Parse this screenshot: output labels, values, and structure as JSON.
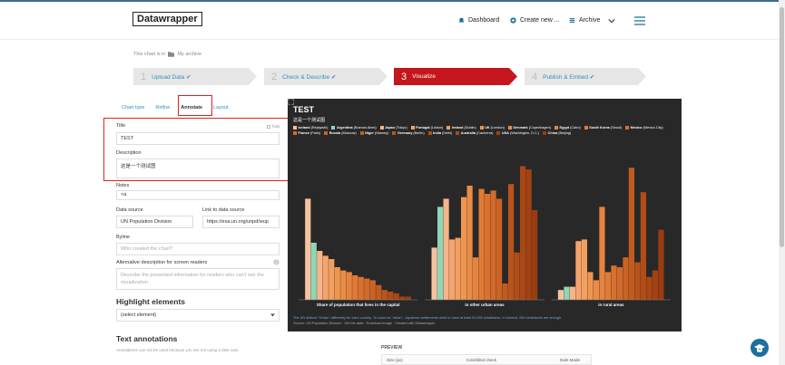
{
  "header": {
    "logo": "Datawrapper",
    "nav": [
      {
        "label": "Dashboard",
        "icon": "bell-icon"
      },
      {
        "label": "Create new ...",
        "icon": "plus-circle-icon"
      },
      {
        "label": "Archive",
        "icon": "folder-icon"
      }
    ]
  },
  "breadcrumb": {
    "prefix": "This chart is in",
    "folder": "My archive"
  },
  "steps": [
    {
      "num": "1",
      "label": "Upload Data ✔"
    },
    {
      "num": "2",
      "label": "Check & Describe ✔"
    },
    {
      "num": "3",
      "label": "Visualize"
    },
    {
      "num": "4",
      "label": "Publish & Embed ✔"
    }
  ],
  "tabs": [
    "Chart type",
    "Refine",
    "Annotate",
    "Layout"
  ],
  "form": {
    "title_label": "Title",
    "hide_label": "hide",
    "title_value": "TEST",
    "description_label": "Description",
    "description_value": "这是一个测试图",
    "notes_label": "Notes",
    "notes_value": "<a",
    "source_label": "Data source",
    "source_value": "UN Population Division",
    "link_label": "Link to data source",
    "link_value": "https://esa.un.org/unpd/wup",
    "byline_label": "Byline",
    "byline_placeholder": "Who created the chart?",
    "alt_label": "Alternative description for screen readers",
    "alt_placeholder": "Describe the presented information for readers who can't see the visualization.",
    "highlight_title": "Highlight elements",
    "highlight_select": "(select element)",
    "text_ann_title": "Text annotations",
    "text_ann_hint": "Annotations can not be used because you are not using a date axis."
  },
  "chart": {
    "title": "TEST",
    "description": "这是一个测试图",
    "notes_line": "The UN defines \"Urban\" differently for each country. To count as \"urban\", Japanese settlements need to have at least 50,000 inhabitants. In Iceland, 200 inhabitants are enough.",
    "source_line": "Source: UN Population Division · Get the data · Download image · Created with Datawrapper"
  },
  "chart_data": {
    "type": "bar",
    "title": "TEST",
    "subtitle": "这是一个测试图",
    "categories": [
      "Share of population that lives in the capital",
      "in other urban areas",
      "in rural areas"
    ],
    "series": [
      {
        "name": "Iceland (Reykjavik)",
        "color": "#f7c2a0",
        "values": [
          62,
          32,
          6
        ]
      },
      {
        "name": "Argentina (Buenos Aires)",
        "color": "#8fd6b5",
        "values": [
          35,
          57,
          8
        ]
      },
      {
        "name": "Japan (Tokyo)",
        "color": "#f7b48a",
        "values": [
          30,
          62,
          8
        ]
      },
      {
        "name": "Portugal (Lisbon)",
        "color": "#f5a46e",
        "values": [
          27,
          37,
          36
        ]
      },
      {
        "name": "Ireland (Dublin)",
        "color": "#f2a05f",
        "values": [
          25,
          38,
          37
        ]
      },
      {
        "name": "UK (London)",
        "color": "#ee9650",
        "values": [
          20,
          63,
          17
        ]
      },
      {
        "name": "Denmark (Copenhagen)",
        "color": "#ea8c46",
        "values": [
          18,
          70,
          12
        ]
      },
      {
        "name": "Egypt (Cairo)",
        "color": "#e5843e",
        "values": [
          17,
          26,
          57
        ]
      },
      {
        "name": "South Korea (Seoul)",
        "color": "#e07a36",
        "values": [
          15,
          68,
          17
        ]
      },
      {
        "name": "Mexico (Mexico City)",
        "color": "#d8712f",
        "values": [
          14,
          65,
          21
        ]
      },
      {
        "name": "France (Paris)",
        "color": "#d26a2a",
        "values": [
          13,
          67,
          20
        ]
      },
      {
        "name": "Russia (Moscow)",
        "color": "#ca6325",
        "values": [
          12,
          62,
          26
        ]
      },
      {
        "name": "Niger (Niamey)",
        "color": "#c25b20",
        "values": [
          9,
          10,
          81
        ]
      },
      {
        "name": "Germany (Berlin)",
        "color": "#ba541c",
        "values": [
          6,
          71,
          23
        ]
      },
      {
        "name": "India (Delhi)",
        "color": "#b24d18",
        "values": [
          5,
          29,
          66
        ]
      },
      {
        "name": "Australia (Canberra)",
        "color": "#aa4715",
        "values": [
          4,
          82,
          14
        ]
      },
      {
        "name": "USA (Washington, D.C.)",
        "color": "#a24112",
        "values": [
          2,
          80,
          18
        ]
      },
      {
        "name": "China (Beijing)",
        "color": "#9a3c10",
        "values": [
          2,
          55,
          43
        ]
      }
    ],
    "ylim": [
      0,
      90
    ]
  },
  "preview": {
    "label": "PREVIEW",
    "size": "Size (px)",
    "colorblind": "Colorblind check",
    "dark": "Dark Mode"
  }
}
